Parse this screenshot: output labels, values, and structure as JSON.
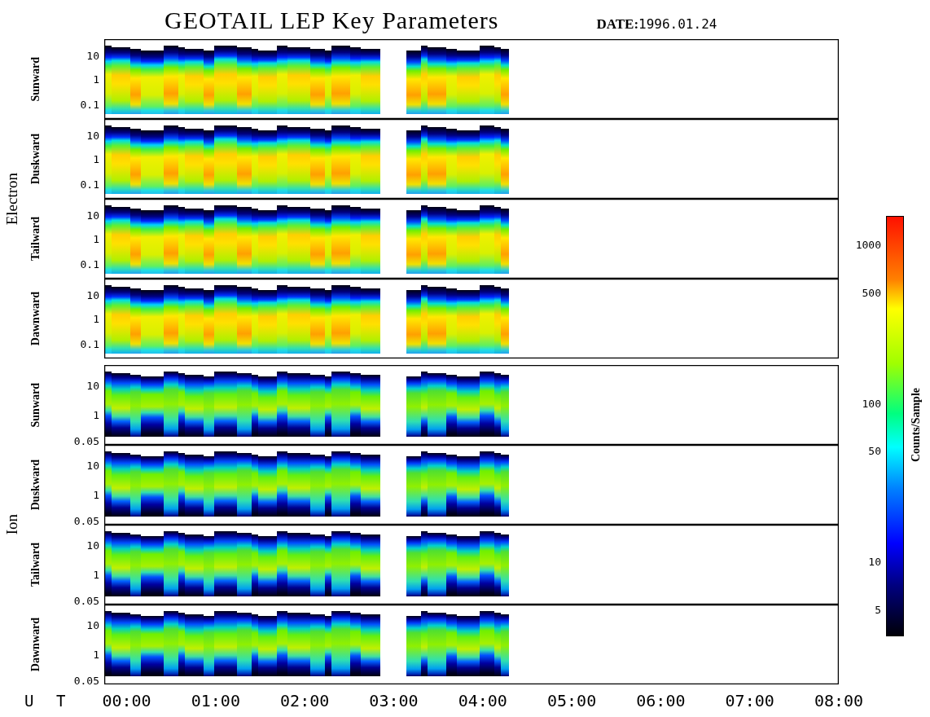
{
  "title": "GEOTAIL LEP Key Parameters",
  "date": {
    "label": "DATE:",
    "value": "1996.01.24"
  },
  "groups": [
    {
      "name": "Electron",
      "kind": "electron",
      "panels": [
        {
          "label": "Sunward",
          "yticks": [
            "10",
            "1",
            "0.1"
          ]
        },
        {
          "label": "Duskward",
          "yticks": [
            "10",
            "1",
            "0.1"
          ]
        },
        {
          "label": "Tailward",
          "yticks": [
            "10",
            "1",
            "0.1"
          ]
        },
        {
          "label": "Dawnward",
          "yticks": [
            "10",
            "1",
            "0.1"
          ]
        }
      ]
    },
    {
      "name": "Ion",
      "kind": "ion",
      "panels": [
        {
          "label": "Sunward",
          "yticks": [
            "10",
            "1",
            "0.05"
          ]
        },
        {
          "label": "Duskward",
          "yticks": [
            "10",
            "1",
            "0.05"
          ]
        },
        {
          "label": "Tailward",
          "yticks": [
            "10",
            "1",
            "0.05"
          ]
        },
        {
          "label": "Dawnward",
          "yticks": [
            "10",
            "1",
            "0.05"
          ]
        }
      ]
    }
  ],
  "x_axis": {
    "label": "U T",
    "ticks": [
      "00:00",
      "01:00",
      "02:00",
      "03:00",
      "04:00",
      "05:00",
      "06:00",
      "07:00",
      "08:00"
    ]
  },
  "colorbar": {
    "label": "Counts/Sample",
    "ticks": [
      "1000",
      "500",
      "100",
      "50",
      "10",
      "5"
    ]
  }
}
